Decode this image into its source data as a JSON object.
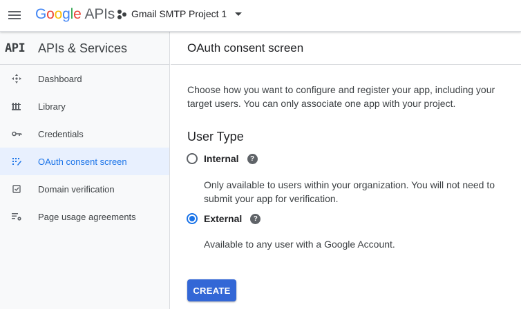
{
  "header": {
    "logo_google": [
      "G",
      "o",
      "o",
      "g",
      "l",
      "e"
    ],
    "logo_apis": "APIs",
    "project_name": "Gmail SMTP Project 1"
  },
  "sidebar": {
    "api_logo": "API",
    "title": "APIs & Services",
    "items": [
      {
        "label": "Dashboard",
        "icon": "dashboard-icon"
      },
      {
        "label": "Library",
        "icon": "library-icon"
      },
      {
        "label": "Credentials",
        "icon": "key-icon"
      },
      {
        "label": "OAuth consent screen",
        "icon": "consent-icon",
        "active": true
      },
      {
        "label": "Domain verification",
        "icon": "checkbox-icon"
      },
      {
        "label": "Page usage agreements",
        "icon": "settings-list-icon"
      }
    ]
  },
  "main": {
    "title": "OAuth consent screen",
    "description": "Choose how you want to configure and register your app, including your target users. You can only associate one app with your project.",
    "section_title": "User Type",
    "options": [
      {
        "label": "Internal",
        "checked": false,
        "help": "?",
        "description": "Only available to users within your organization. You will not need to submit your app for verification."
      },
      {
        "label": "External",
        "checked": true,
        "help": "?",
        "description": "Available to any user with a Google Account."
      }
    ],
    "create_label": "CREATE"
  },
  "colors": {
    "accent": "#1a73e8",
    "button": "#3367d6",
    "active_bg": "#e8f0fe"
  }
}
